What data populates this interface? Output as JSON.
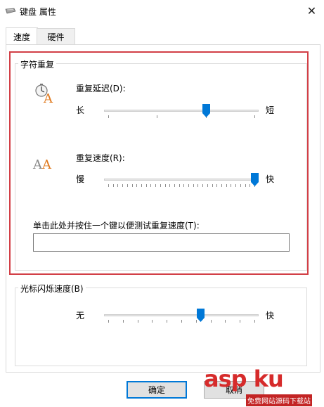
{
  "window": {
    "title": "键盘 属性",
    "close_glyph": "✕"
  },
  "tabs": [
    {
      "label": "速度",
      "active": true
    },
    {
      "label": "硬件",
      "active": false
    }
  ],
  "char_repeat": {
    "group_label": "字符重复",
    "delay": {
      "label": "重复延迟(D):",
      "min_label": "长",
      "max_label": "短",
      "value_fraction": 0.67,
      "tick_count": 4
    },
    "rate": {
      "label": "重复速度(R):",
      "min_label": "慢",
      "max_label": "快",
      "value_fraction": 1.0,
      "tick_count": 32
    },
    "test": {
      "label": "单击此处并按住一个键以便测试重复速度(T):",
      "value": ""
    }
  },
  "cursor_blink": {
    "group_label": "光标闪烁速度(B)",
    "min_label": "无",
    "max_label": "快",
    "value_fraction": 0.63,
    "tick_count": 11
  },
  "buttons": {
    "ok_label": "确定",
    "cancel_label": "取消"
  },
  "watermark": {
    "main": "asp ku",
    "sub": "免费网站源码下载站"
  },
  "colors": {
    "accent": "#0078d7",
    "highlight": "#d23f46"
  }
}
